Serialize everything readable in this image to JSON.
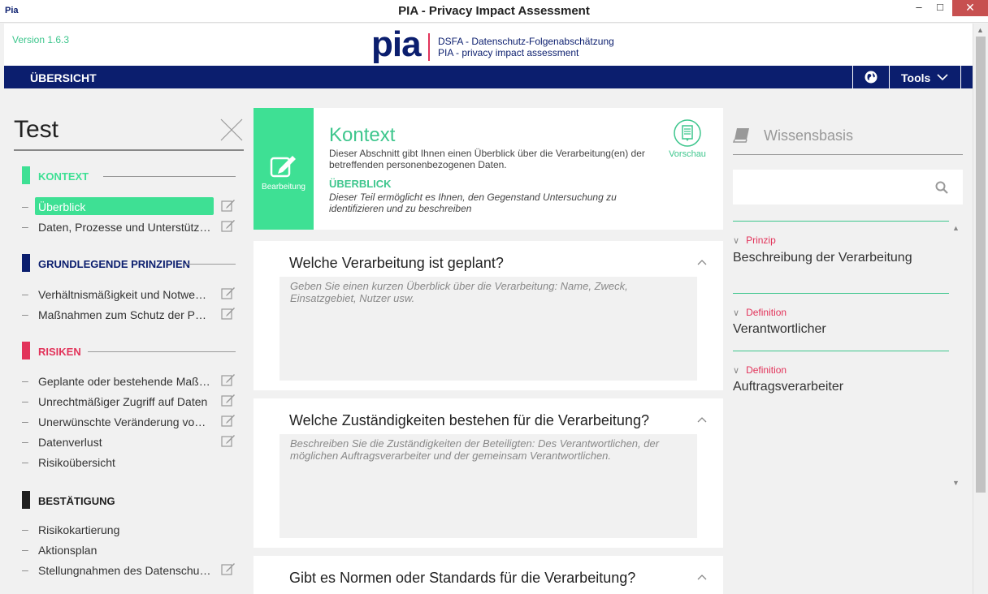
{
  "window": {
    "app_icon_text": "Pia",
    "title": "PIA - Privacy Impact Assessment",
    "minimize": "–",
    "maximize": "□",
    "close": "✕"
  },
  "header": {
    "version": "Version 1.6.3",
    "logo": "pia",
    "subtitle_1": "DSFA - Datenschutz-Folgenabschätzung",
    "subtitle_2": "PIA - privacy impact assessment"
  },
  "nav": {
    "overview": "ÜBERSICHT",
    "tools": "Tools"
  },
  "sidebar": {
    "pia_name": "Test",
    "sections": [
      {
        "label": "KONTEXT",
        "color": "#3ee094",
        "items": [
          {
            "label": "Überblick",
            "active": true,
            "editable": true
          },
          {
            "label": "Daten, Prozesse und Unterstützende Anlagen",
            "active": false,
            "editable": true
          }
        ]
      },
      {
        "label": "GRUNDLEGENDE PRINZIPIEN",
        "color": "#0b1e6e",
        "items": [
          {
            "label": "Verhältnismäßigkeit und Notwendigkeit",
            "active": false,
            "editable": true
          },
          {
            "label": "Maßnahmen zum Schutz der Personen",
            "active": false,
            "editable": true
          }
        ]
      },
      {
        "label": "RISIKEN",
        "color": "#e2335a",
        "items": [
          {
            "label": "Geplante oder bestehende Maßnahmen",
            "active": false,
            "editable": true
          },
          {
            "label": "Unrechtmäßiger Zugriff auf Daten",
            "active": false,
            "editable": true
          },
          {
            "label": "Unerwünschte Veränderung von Daten",
            "active": false,
            "editable": true
          },
          {
            "label": "Datenverlust",
            "active": false,
            "editable": true
          },
          {
            "label": "Risikoübersicht",
            "active": false,
            "editable": false
          }
        ]
      },
      {
        "label": "BESTÄTIGUNG",
        "color": "#1e1e1e",
        "items": [
          {
            "label": "Risikokartierung",
            "active": false,
            "editable": false
          },
          {
            "label": "Aktionsplan",
            "active": false,
            "editable": false
          },
          {
            "label": "Stellungnahmen des Datenschutzbeauftragten",
            "active": false,
            "editable": true
          }
        ]
      }
    ]
  },
  "main": {
    "edit_label": "Bearbeitung",
    "title": "Kontext",
    "description": "Dieser Abschnitt gibt Ihnen einen Überblick über die Verarbeitung(en) der betreffenden personenbezogenen Daten.",
    "subtitle": "ÜBERBLICK",
    "subdescription": "Dieser Teil ermöglicht es Ihnen, den Gegenstand Untersuchung zu identifizieren und zu beschreiben",
    "preview_label": "Vorschau",
    "questions": [
      {
        "title": "Welche Verarbeitung ist geplant?",
        "placeholder": "Geben Sie einen kurzen Überblick über die Verarbeitung: Name, Zweck, Einsatzgebiet, Nutzer usw."
      },
      {
        "title": "Welche Zuständigkeiten bestehen für die Verarbeitung?",
        "placeholder": "Beschreiben Sie die Zuständigkeiten der Beteiligten: Des Verantwortlichen, der möglichen Auftragsverarbeiter und der gemeinsam Verantwortlichen."
      },
      {
        "title": "Gibt es Normen oder Standards für die Verarbeitung?",
        "placeholder": ""
      }
    ]
  },
  "knowledge": {
    "title": "Wissensbasis",
    "search_value": "",
    "entries": [
      {
        "category": "Prinzip",
        "name": "Beschreibung der Verarbeitung"
      },
      {
        "category": "Definition",
        "name": "Verantwortlicher"
      },
      {
        "category": "Definition",
        "name": "Auftragsverarbeiter"
      }
    ]
  }
}
